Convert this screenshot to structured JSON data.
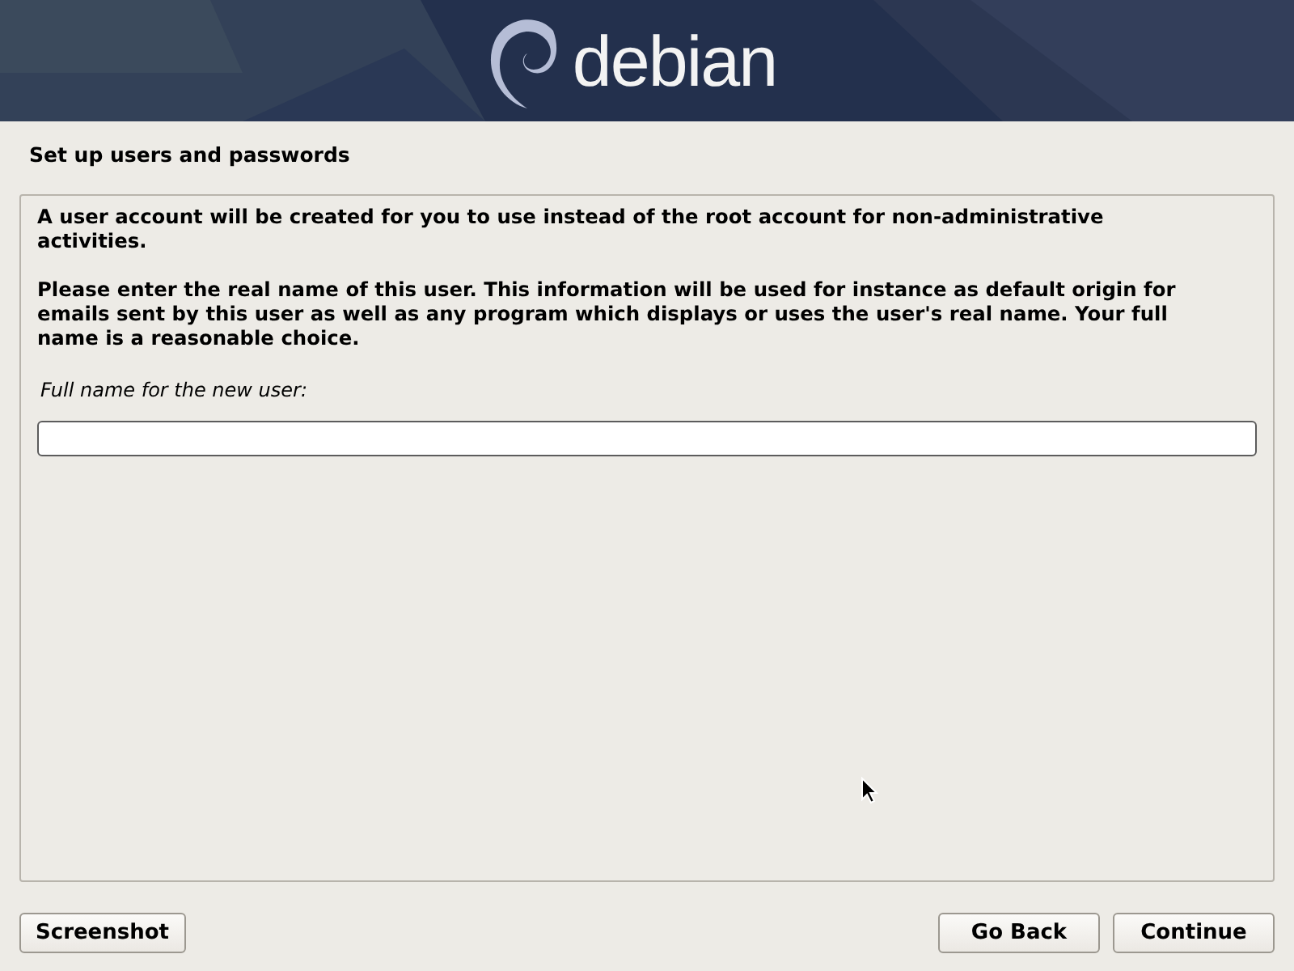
{
  "header": {
    "logo_text": "debian"
  },
  "title": "Set up users and passwords",
  "paragraphs": [
    "A user account will be created for you to use instead of the root account for non-administrative activities.",
    "Please enter the real name of this user. This information will be used for instance as default origin for emails sent by this user as well as any program which displays or uses the user's real name. Your full name is a reasonable choice."
  ],
  "field": {
    "label": "Full name for the new user:"
  },
  "buttons": [
    {
      "label": "Screenshot",
      "kind": "left"
    },
    {
      "label": "Go Back",
      "kind": "right"
    },
    {
      "label": "Continue",
      "kind": "right"
    }
  ]
}
